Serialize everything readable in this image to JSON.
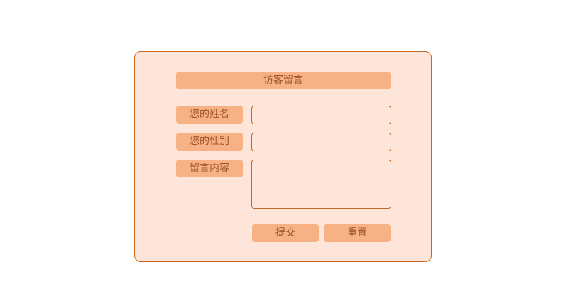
{
  "form": {
    "title": "访客留言",
    "name_label": "您的姓名",
    "name_value": "",
    "gender_label": "您的性别",
    "gender_value": "",
    "message_label": "留言内容",
    "message_value": "",
    "submit_label": "提交",
    "reset_label": "重置"
  },
  "colors": {
    "panel_background": "#fde5d9",
    "border": "#c8651e",
    "label_background": "#f6b184",
    "text": "#a2522b"
  }
}
